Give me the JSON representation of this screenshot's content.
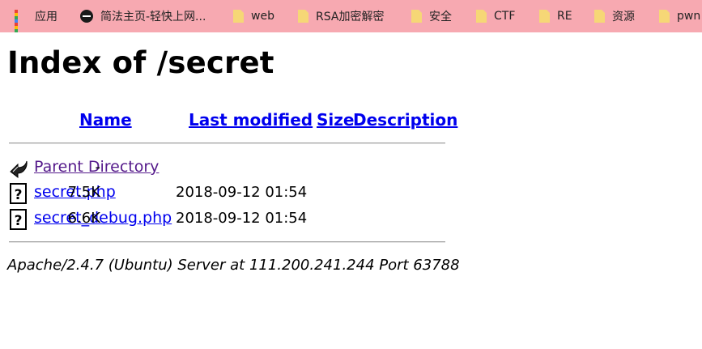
{
  "bookmarks": [
    {
      "label": "应用",
      "icon": "apps-grid-icon"
    },
    {
      "label": "简法主页-轻快上网...",
      "icon": "stop-sign-icon"
    },
    {
      "label": "web",
      "icon": "folder-icon"
    },
    {
      "label": "RSA加密解密",
      "icon": "folder-icon"
    },
    {
      "label": "安全",
      "icon": "folder-icon"
    },
    {
      "label": "CTF",
      "icon": "folder-icon"
    },
    {
      "label": "RE",
      "icon": "folder-icon"
    },
    {
      "label": "资源",
      "icon": "folder-icon"
    },
    {
      "label": "pwn",
      "icon": "folder-icon"
    }
  ],
  "page": {
    "title": "Index of /secret",
    "columns": {
      "name": "Name",
      "last_modified": "Last modified",
      "size": "Size",
      "description": "Description"
    },
    "rows": [
      {
        "name": "Parent Directory",
        "modified": "",
        "size": "-",
        "icon": "back-arrow-icon"
      },
      {
        "name": "secret.php",
        "modified": "2018-09-12 01:54",
        "size": "7.5K",
        "icon": "unknown-file-icon"
      },
      {
        "name": "secret_debug.php",
        "modified": "2018-09-12 01:54",
        "size": "6.6K",
        "icon": "unknown-file-icon"
      }
    ],
    "footer": "Apache/2.4.7 (Ubuntu) Server at 111.200.241.244 Port 63788"
  },
  "colors": {
    "bookmark_bar": "#f7a9b1",
    "link": "#0000ee",
    "visited_link": "#551a8b",
    "folder": "#f6d776"
  }
}
